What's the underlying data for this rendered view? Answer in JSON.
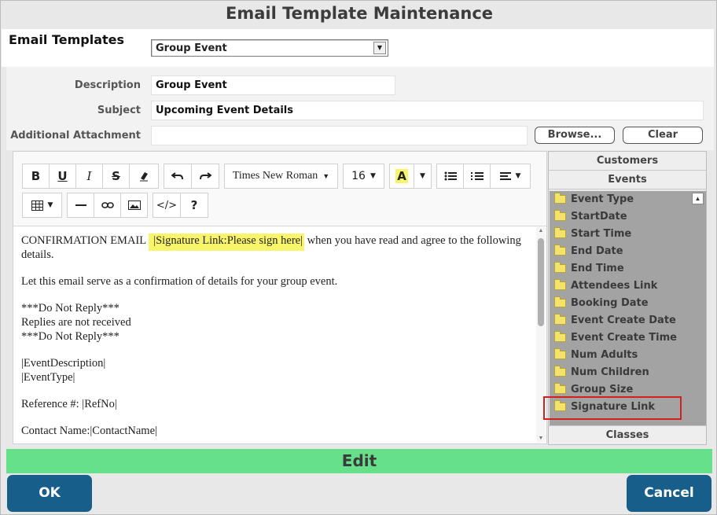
{
  "window": {
    "title": "Email Template Maintenance"
  },
  "templates": {
    "label": "Email Templates",
    "selected": "Group Event"
  },
  "form": {
    "description_label": "Description",
    "description_value": "Group Event",
    "subject_label": "Subject",
    "subject_value": "Upcoming Event Details",
    "attachment_label": "Additional Attachment",
    "attachment_value": "",
    "browse_label": "Browse...",
    "clear_label": "Clear"
  },
  "toolbar": {
    "bold": "B",
    "underline": "U",
    "italic": "I",
    "strike": "S",
    "font_name": "Times New Roman",
    "font_size": "16",
    "font_color": "A",
    "code_view": "</>",
    "help": "?"
  },
  "content": {
    "line1_before": "CONFIRMATION EMAIL ",
    "signature_link": "|Signature Link:Please sign here|",
    "line1_after": " when you have read and agree to the following details.",
    "para2": "Let this email serve as a confirmation of details for your group event.",
    "para3_1": "***Do Not Reply***",
    "para3_2": "Replies are not received",
    "para3_3": "***Do Not Reply***",
    "para4_1": "|EventDescription|",
    "para4_2": "|EventType|",
    "para5": "Reference #: |RefNo|",
    "para6": "Contact Name:|ContactName|"
  },
  "side": {
    "customers": "Customers",
    "events": "Events",
    "classes": "Classes",
    "items": [
      "Event Type",
      "StartDate",
      "Start Time",
      "End Date",
      "End Time",
      "Attendees Link",
      "Booking Date",
      "Event Create Date",
      "Event Create Time",
      "Num Adults",
      "Num Children",
      "Group Size",
      "Signature Link"
    ]
  },
  "footer": {
    "edit_label": "Edit",
    "ok_label": "OK",
    "cancel_label": "Cancel"
  },
  "colors": {
    "primary_button": "#175f8a",
    "edit_bar": "#67e08b",
    "highlight": "#f9f56b",
    "annotation": "#d21f1f"
  }
}
